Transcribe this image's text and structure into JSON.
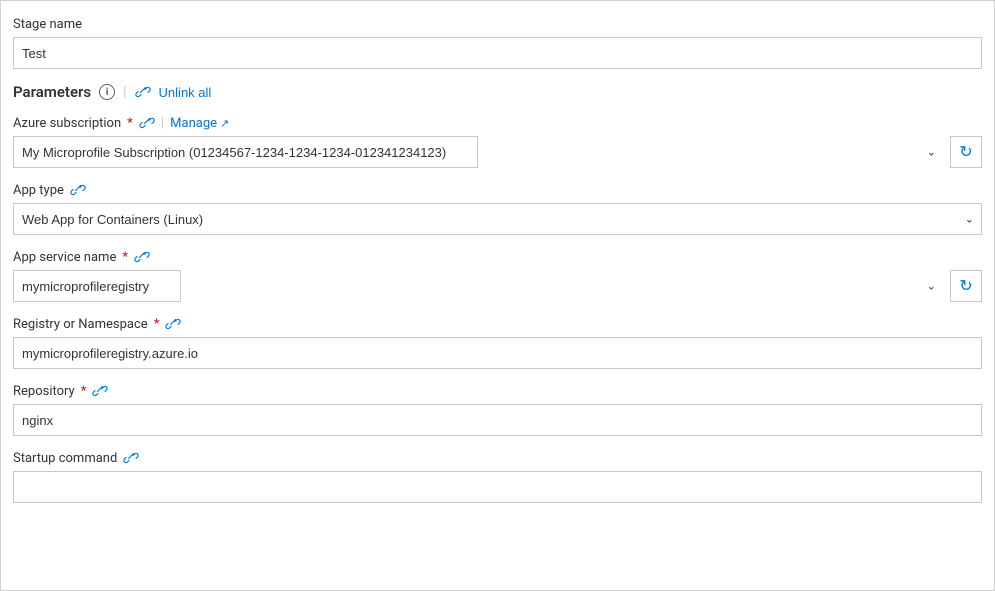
{
  "stage": {
    "label": "Stage name",
    "value": "Test"
  },
  "parameters": {
    "title": "Parameters",
    "unlink_all_label": "Unlink all"
  },
  "azure_subscription": {
    "label": "Azure subscription",
    "required": true,
    "manage_label": "Manage",
    "value": "My Microprofile Subscription (01234567-1234-1234-1234-012341234123)",
    "options": [
      "My Microprofile Subscription (01234567-1234-1234-1234-012341234123)"
    ]
  },
  "app_type": {
    "label": "App type",
    "value": "Web App for Containers (Linux)",
    "options": [
      "Web App for Containers (Linux)"
    ]
  },
  "app_service_name": {
    "label": "App service name",
    "required": true,
    "value": "mymicroprofileregistry",
    "options": [
      "mymicroprofileregistry"
    ]
  },
  "registry_namespace": {
    "label": "Registry or Namespace",
    "required": true,
    "value": "mymicroprofileregistry.azure.io"
  },
  "repository": {
    "label": "Repository",
    "required": true,
    "value": "nginx"
  },
  "startup_command": {
    "label": "Startup command",
    "value": ""
  }
}
